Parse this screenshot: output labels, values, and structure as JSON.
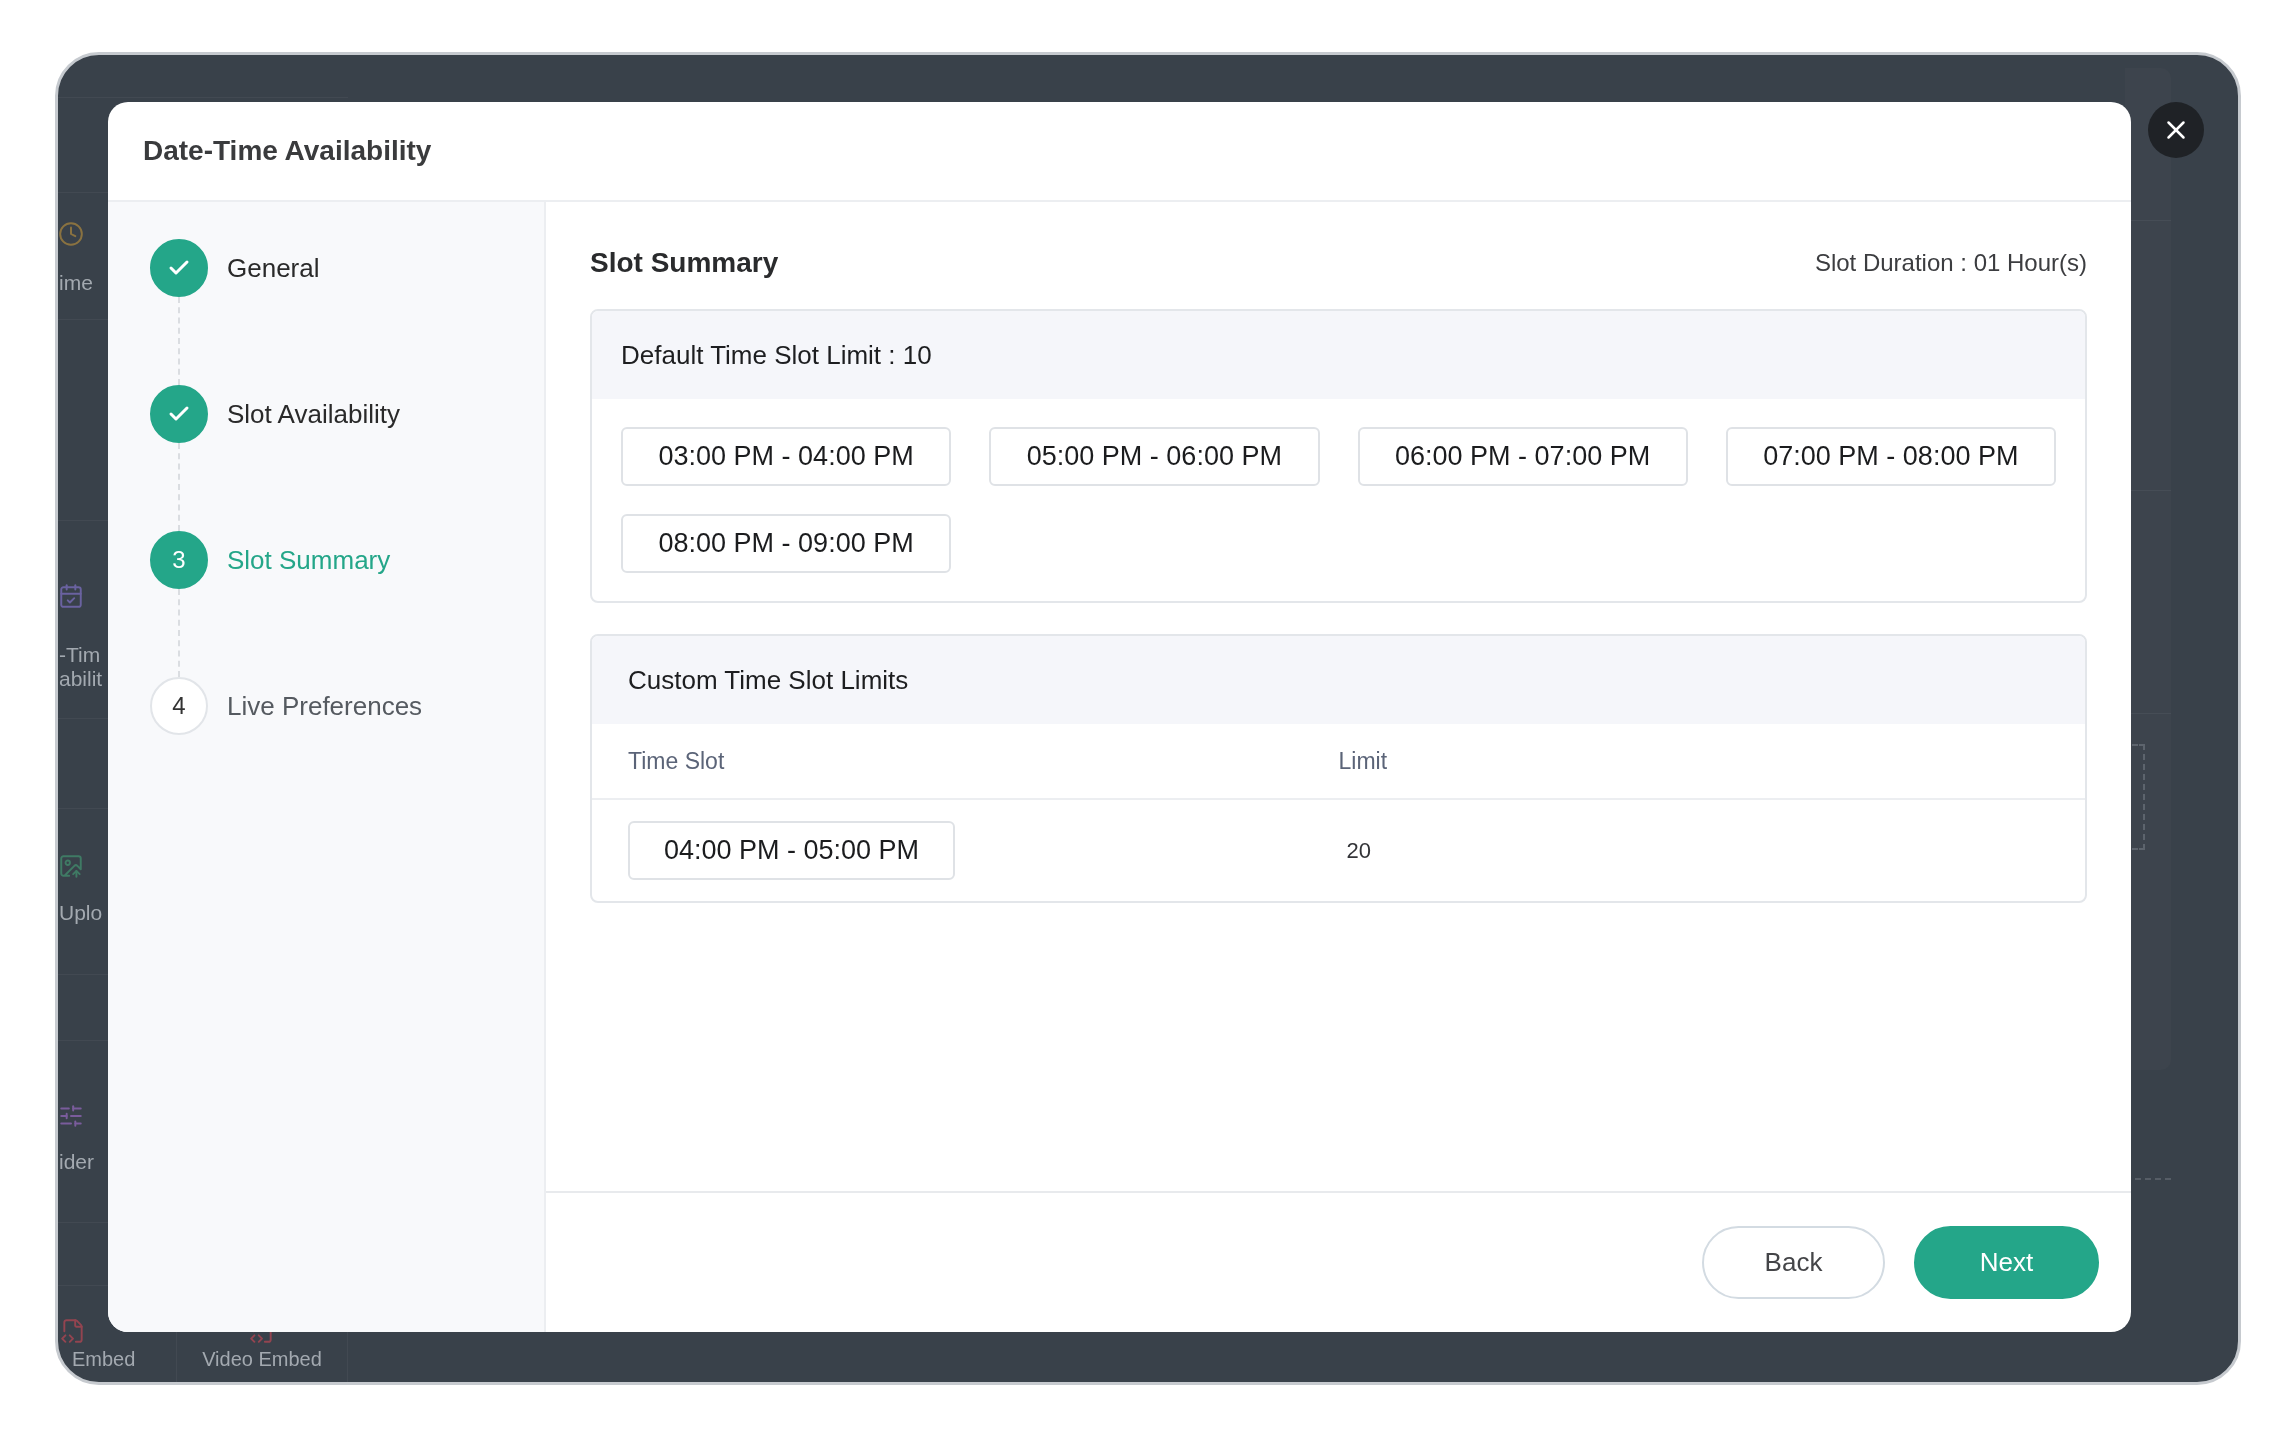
{
  "background_tiles": [
    {
      "label": "ime"
    },
    {
      "label": "-Tim abilit"
    },
    {
      "label": "Uplo"
    },
    {
      "label": "ider"
    },
    {
      "label": "Embed"
    },
    {
      "label": "Video Embed"
    }
  ],
  "dialog": {
    "title": "Date-Time Availability",
    "steps": [
      {
        "label": "General",
        "completed": true,
        "selected": false
      },
      {
        "label": "Slot Availability",
        "completed": true,
        "selected": false
      },
      {
        "number": "3",
        "label": "Slot Summary",
        "completed": false,
        "selected": true
      },
      {
        "number": "4",
        "label": "Live Preferences",
        "completed": false,
        "selected": false
      }
    ],
    "slot_summary": {
      "title": "Slot Summary",
      "duration": "Slot Duration : 01 Hour(s)",
      "default_limits": {
        "title": "Default Time Slot Limit : 10",
        "slots": [
          "03:00 PM - 04:00 PM",
          "05:00 PM - 06:00 PM",
          "06:00 PM - 07:00 PM",
          "07:00 PM - 08:00 PM",
          "08:00 PM - 09:00 PM"
        ]
      },
      "custom_limits": {
        "title": "Custom Time Slot Limits",
        "columns": [
          "Time Slot",
          "Limit"
        ],
        "rows": [
          {
            "time_slot": "04:00 PM - 05:00 PM",
            "limit": "20"
          }
        ]
      }
    },
    "buttons": [
      {
        "label": "Back",
        "kind": "secondary"
      },
      {
        "label": "Next",
        "kind": "primary"
      }
    ]
  }
}
